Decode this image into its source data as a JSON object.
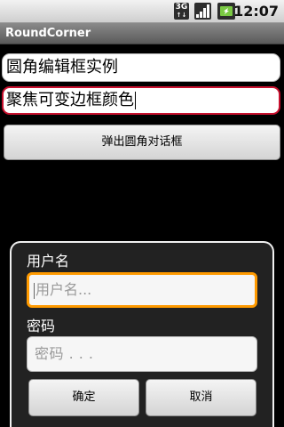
{
  "status_bar": {
    "network_label": "3G",
    "network_arrows": "↑↓",
    "time": "12:07",
    "icons": [
      "network-3g-icon",
      "signal-icon",
      "battery-charging-icon"
    ]
  },
  "title_bar": {
    "title": "RoundCorner"
  },
  "main": {
    "edit_one_value": "圆角编辑框实例",
    "edit_two_value": "聚焦可变边框颜色",
    "popup_button_label": "弹出圆角对话框"
  },
  "dialog": {
    "username_label": "用户名",
    "username_placeholder": "用户名...",
    "password_label": "密码",
    "password_placeholder": "密码 . . .",
    "ok_label": "确定",
    "cancel_label": "取消"
  },
  "colors": {
    "focus_border_red": "#c8102e",
    "focus_border_orange": "#ff9a00",
    "dialog_bg": "#222222",
    "background": "#000000"
  }
}
